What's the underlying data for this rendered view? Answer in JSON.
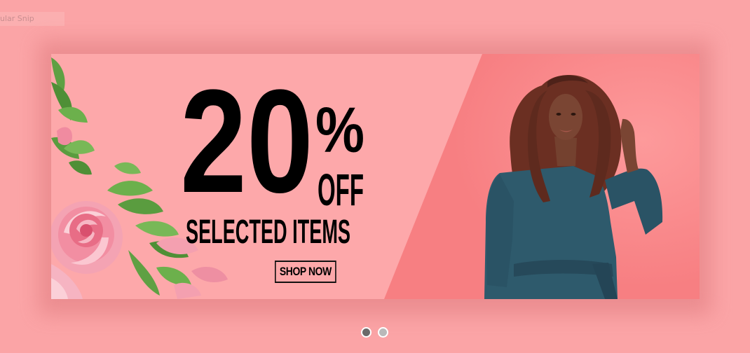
{
  "snip_tab": {
    "label": "ular Snip"
  },
  "banner": {
    "discount_number": "20",
    "percent_sign": "%",
    "off_label": "OFF",
    "subtitle": "SELECTED ITEMS",
    "cta_label": "SHOP NOW"
  },
  "carousel": {
    "slides": [
      "slide-1",
      "slide-2"
    ],
    "active_slide": 1
  },
  "colors": {
    "page_bg": "#fba4a6",
    "banner_bg": "#fda8aa",
    "photo_bg": "#f98385",
    "dress": "#2e5a6c",
    "hair": "#6b2f22",
    "skin": "#7a4533"
  }
}
